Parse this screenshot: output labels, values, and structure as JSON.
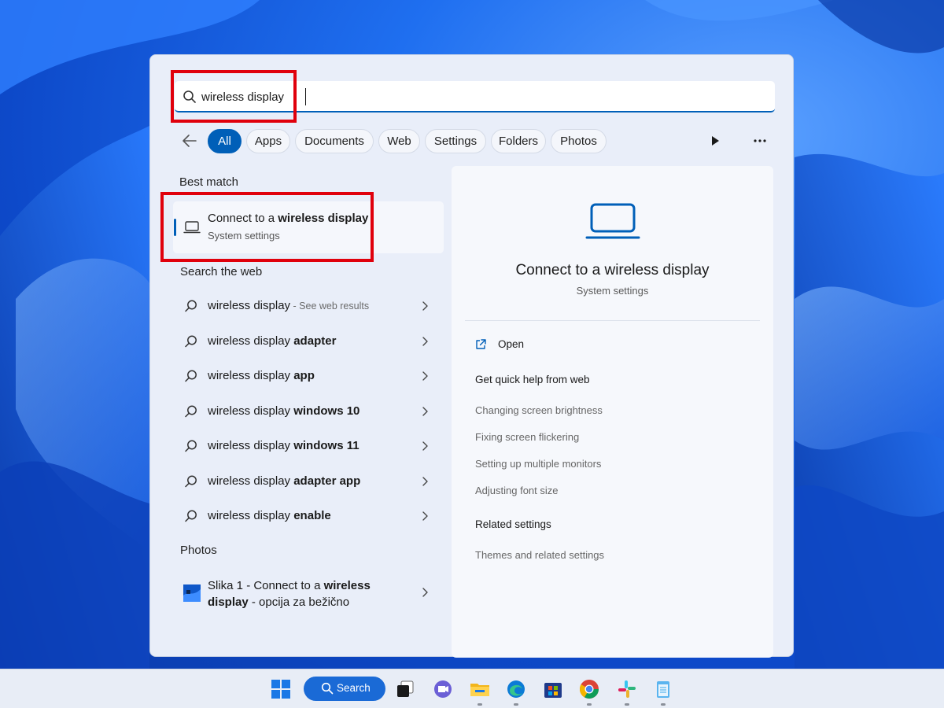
{
  "search": {
    "query": "wireless display",
    "icon": "search-icon"
  },
  "filters": {
    "back_icon": "arrow-left-icon",
    "chips": [
      "All",
      "Apps",
      "Documents",
      "Web",
      "Settings",
      "Folders",
      "Photos"
    ],
    "active": "All",
    "play_icon": "play-icon",
    "more_icon": "more-icon"
  },
  "results": {
    "best_match_label": "Best match",
    "best_match": {
      "title_prefix": "Connect to a ",
      "title_bold": "wireless display",
      "subtitle": "System settings",
      "icon": "laptop-icon"
    },
    "search_web_label": "Search the web",
    "web_items": [
      {
        "prefix": "wireless display",
        "bold": "",
        "suffix": " - See web results"
      },
      {
        "prefix": "wireless display ",
        "bold": "adapter",
        "suffix": ""
      },
      {
        "prefix": "wireless display ",
        "bold": "app",
        "suffix": ""
      },
      {
        "prefix": "wireless display ",
        "bold": "windows 10",
        "suffix": ""
      },
      {
        "prefix": "wireless display ",
        "bold": "windows 11",
        "suffix": ""
      },
      {
        "prefix": "wireless display ",
        "bold": "adapter app",
        "suffix": ""
      },
      {
        "prefix": "wireless display ",
        "bold": "enable",
        "suffix": ""
      }
    ],
    "photos_label": "Photos",
    "photo_item": {
      "part1": "Slika 1 - Connect to a ",
      "bold1": "wireless",
      "bold2": "display",
      "part2": " - opcija za bežično"
    }
  },
  "preview": {
    "icon": "laptop-icon",
    "title": "Connect to a wireless display",
    "subtitle": "System settings",
    "open_label": "Open",
    "open_icon": "open-external-icon",
    "quick_help_heading": "Get quick help from web",
    "quick_help_links": [
      "Changing screen brightness",
      "Fixing screen flickering",
      "Setting up multiple monitors",
      "Adjusting font size"
    ],
    "related_heading": "Related settings",
    "related_links": [
      "Themes and related settings"
    ]
  },
  "taskbar": {
    "search_label": "Search",
    "apps": [
      "windows-start-icon",
      "task-view-icon",
      "teams-chat-icon",
      "file-explorer-icon",
      "edge-icon",
      "store-icon",
      "chrome-icon",
      "slack-icon",
      "notepad-icon"
    ]
  },
  "colors": {
    "accent": "#005fb8",
    "highlight": "#e0000c"
  }
}
